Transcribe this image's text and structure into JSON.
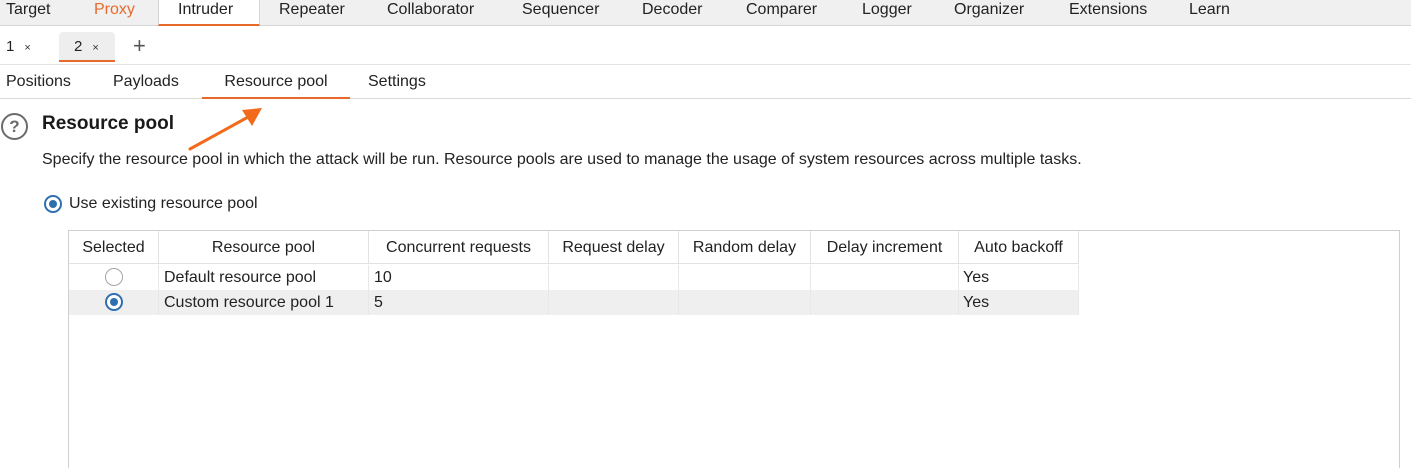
{
  "main_tabs": [
    {
      "label": "Target"
    },
    {
      "label": "Proxy"
    },
    {
      "label": "Intruder"
    },
    {
      "label": "Repeater"
    },
    {
      "label": "Collaborator"
    },
    {
      "label": "Sequencer"
    },
    {
      "label": "Decoder"
    },
    {
      "label": "Comparer"
    },
    {
      "label": "Logger"
    },
    {
      "label": "Organizer"
    },
    {
      "label": "Extensions"
    },
    {
      "label": "Learn"
    }
  ],
  "instance_tabs": [
    {
      "label": "1",
      "close": "×"
    },
    {
      "label": "2",
      "close": "×"
    }
  ],
  "add_tab": "+",
  "sub_tabs": [
    {
      "label": "Positions"
    },
    {
      "label": "Payloads"
    },
    {
      "label": "Resource pool"
    },
    {
      "label": "Settings"
    }
  ],
  "section": {
    "help_icon": "?",
    "title": "Resource pool",
    "description": "Specify the resource pool in which the attack will be run. Resource pools are used to manage the usage of system resources across multiple tasks.",
    "option_label": "Use existing resource pool"
  },
  "table": {
    "columns": [
      "Selected",
      "Resource pool",
      "Concurrent requests",
      "Request delay",
      "Random delay",
      "Delay increment",
      "Auto backoff"
    ],
    "rows": [
      {
        "selected": false,
        "pool": "Default resource pool",
        "concurrent": "10",
        "request_delay": "",
        "random_delay": "",
        "delay_increment": "",
        "auto_backoff": "Yes"
      },
      {
        "selected": true,
        "pool": "Custom resource pool 1",
        "concurrent": "5",
        "request_delay": "",
        "random_delay": "",
        "delay_increment": "",
        "auto_backoff": "Yes"
      }
    ]
  },
  "colors": {
    "accent": "#e8692c",
    "radio_selected": "#2f6fb0",
    "annotation_arrow": "#f26b1d"
  }
}
